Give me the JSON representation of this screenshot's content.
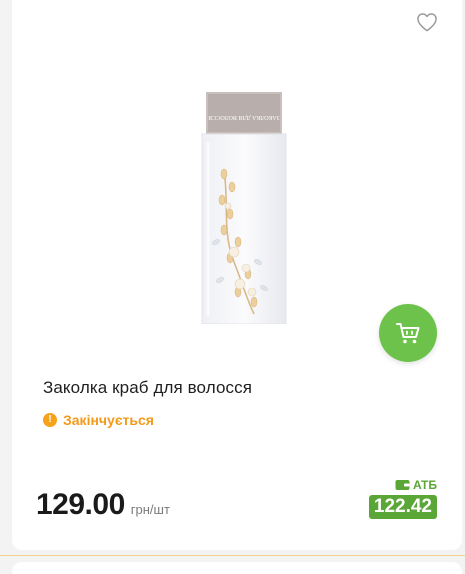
{
  "product": {
    "title": "Заколка краб для волосся",
    "image_alt": "Заколка краб для волосся",
    "stock_status": "Закінчується",
    "price": "129.00",
    "unit": "грн/шт",
    "card_label": "АТБ",
    "card_price": "122.42"
  },
  "icons": {
    "favorite": "heart-outline-icon",
    "cart": "cart-icon",
    "warning": "exclamation-icon",
    "card": "wallet-icon"
  },
  "colors": {
    "accent_green": "#6cc24a",
    "atb_green": "#5aa637",
    "warning_orange": "#f39a1a"
  }
}
